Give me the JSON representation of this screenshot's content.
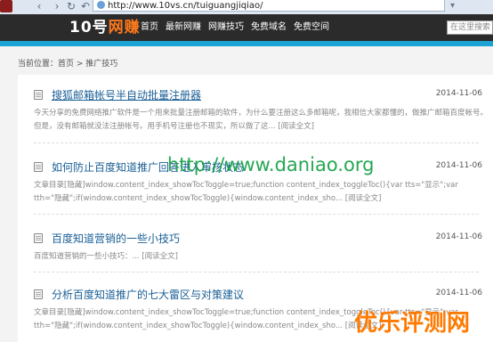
{
  "browser": {
    "url": "http://www.10vs.cn/tuiguangjiqiao/"
  },
  "site": {
    "logo_prefix": "10号",
    "logo_highlight": "网赚",
    "nav": [
      "首页",
      "最新网赚",
      "网赚技巧",
      "免费域名",
      "免费空间"
    ],
    "search_placeholder": "在这里搜索"
  },
  "breadcrumb": "当前位置：首页 > 推广技巧",
  "posts": [
    {
      "title": "搜狐邮箱帐号半自动批量注册器",
      "date": "2014-11-06",
      "excerpt": "今天分享的免费网络推广软件是一个用来批量注册邮箱的软件，为什么要注册这么多邮箱呢，我相信大家都懂的，做推广邮箱百度帐号。但是，没有邮箱就没法注册帐号。用手机号注册也不现实，所以做了这...",
      "more": "[阅读全文]"
    },
    {
      "title": "如何防止百度知道推广回答进入审核状态",
      "date": "2014-11-06",
      "excerpt": "文章目录[隐藏]window.content_index_showTocToggle=true;function content_index_toggleToc(){var tts=\"显示\";var tth=\"隐藏\";if(window.content_index_showTocToggle){window.content_index_sho...",
      "more": "[阅读全文]"
    },
    {
      "title": "百度知道营销的一些小技巧",
      "date": "2014-11-06",
      "excerpt": "百度知道营销的一些小技巧：...",
      "more": "[阅读全文]"
    },
    {
      "title": "分析百度知道推广的七大雷区与对策建议",
      "date": "2014-11-06",
      "excerpt": "文章目录[隐藏]window.content_index_showTocToggle=true;function content_index_toggleToc(){var tts=\"显示\";var tth=\"隐藏\";if(window.content_index_showTocToggle){window.content_index_sho...",
      "more": "[阅读全文]"
    }
  ],
  "watermarks": {
    "url": "http://www.daniao.org",
    "brand": "优乐评测网"
  },
  "colors": {
    "header_bg": "#2b2b2b",
    "accent": "#1ba3d6",
    "link": "#1a5f96",
    "logo_highlight": "#ff7a1a"
  }
}
